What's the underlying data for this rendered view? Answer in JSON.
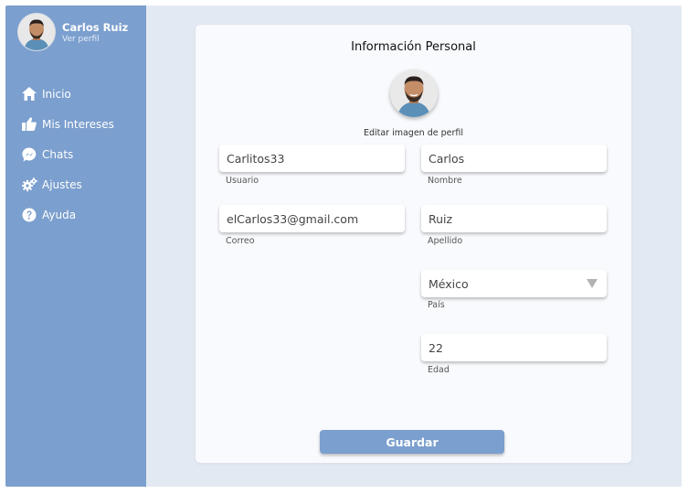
{
  "sidebar": {
    "profile": {
      "name": "Carlos Ruiz",
      "link": "Ver perfil"
    },
    "items": [
      {
        "label": "Inicio",
        "icon": "home-icon"
      },
      {
        "label": "Mis Intereses",
        "icon": "thumbs-up-icon"
      },
      {
        "label": "Chats",
        "icon": "messenger-icon"
      },
      {
        "label": "Ajustes",
        "icon": "gears-icon"
      },
      {
        "label": "Ayuda",
        "icon": "question-icon"
      }
    ]
  },
  "form": {
    "title": "Información Personal",
    "edit_photo_label": "Editar imagen de perfil",
    "username": {
      "value": "Carlitos33",
      "label": "Usuario"
    },
    "name": {
      "value": "Carlos",
      "label": "Nombre"
    },
    "email": {
      "value": "elCarlos33@gmail.com",
      "label": "Correo"
    },
    "lastname": {
      "value": "Ruiz",
      "label": "Apellido"
    },
    "country": {
      "value": "México",
      "label": "País"
    },
    "age": {
      "value": "22",
      "label": "Edad"
    },
    "save_label": "Guardar"
  },
  "colors": {
    "sidebar": "#7b9fce",
    "background": "#e3e9f2",
    "card": "#f8fafd",
    "button": "#7b9fce"
  }
}
